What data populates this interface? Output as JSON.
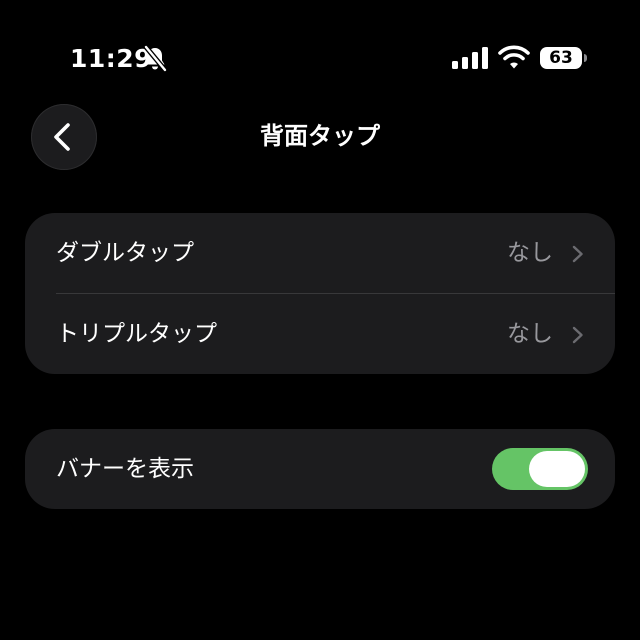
{
  "status_bar": {
    "time": "11:29",
    "battery_level": "63",
    "silent_mode": true,
    "icons": [
      "bell-slash-icon",
      "cellular-signal-icon",
      "wifi-icon",
      "battery-icon"
    ]
  },
  "nav": {
    "title": "背面タップ",
    "back_icon": "chevron-left-icon"
  },
  "back_tap_settings": {
    "rows": [
      {
        "label": "ダブルタップ",
        "value": "なし"
      },
      {
        "label": "トリプルタップ",
        "value": "なし"
      }
    ]
  },
  "banner_setting": {
    "label": "バナーを表示",
    "enabled": true
  },
  "colors": {
    "background": "#000000",
    "group_background": "#1c1c1e",
    "secondary_text": "#98989d",
    "toggle_on": "#65c466"
  }
}
